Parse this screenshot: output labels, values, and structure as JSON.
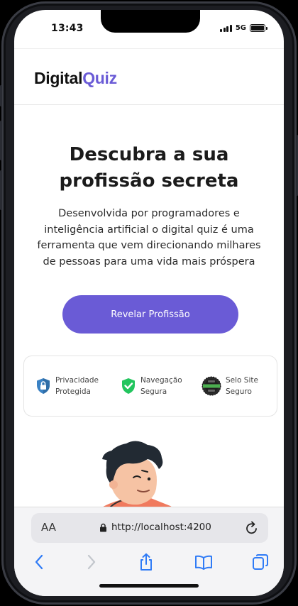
{
  "status_bar": {
    "time": "13:43",
    "network": "5G"
  },
  "header": {
    "logo_part1": "Digital",
    "logo_part2": "Quiz"
  },
  "hero": {
    "title_line1": "Descubra a sua",
    "title_line2": "profissão secreta",
    "desc_line1": "Desenvolvida por programadores e",
    "desc_line2": "inteligência artificial o digital quiz é uma",
    "desc_line3": "ferramenta que vem direcionando milhares",
    "desc_line4": "de pessoas para uma vida mais próspera",
    "cta_label": "Revelar Profissão"
  },
  "trust": {
    "items": [
      {
        "icon": "shield-lock-icon",
        "label": "Privacidade\nProtegida"
      },
      {
        "icon": "shield-check-icon",
        "label": "Navegação\nSegura"
      },
      {
        "icon": "seal-icon",
        "label": "Selo Site\nSeguro"
      }
    ]
  },
  "browser": {
    "aa_label": "AA",
    "url": "http://localhost:4200",
    "toolbar": [
      "back-icon",
      "forward-icon",
      "share-icon",
      "bookmarks-icon",
      "tabs-icon"
    ]
  },
  "colors": {
    "accent": "#6a5bd6",
    "text": "#1b1b1b",
    "check_green": "#22c55e",
    "shield_blue": "#3b82c4"
  }
}
